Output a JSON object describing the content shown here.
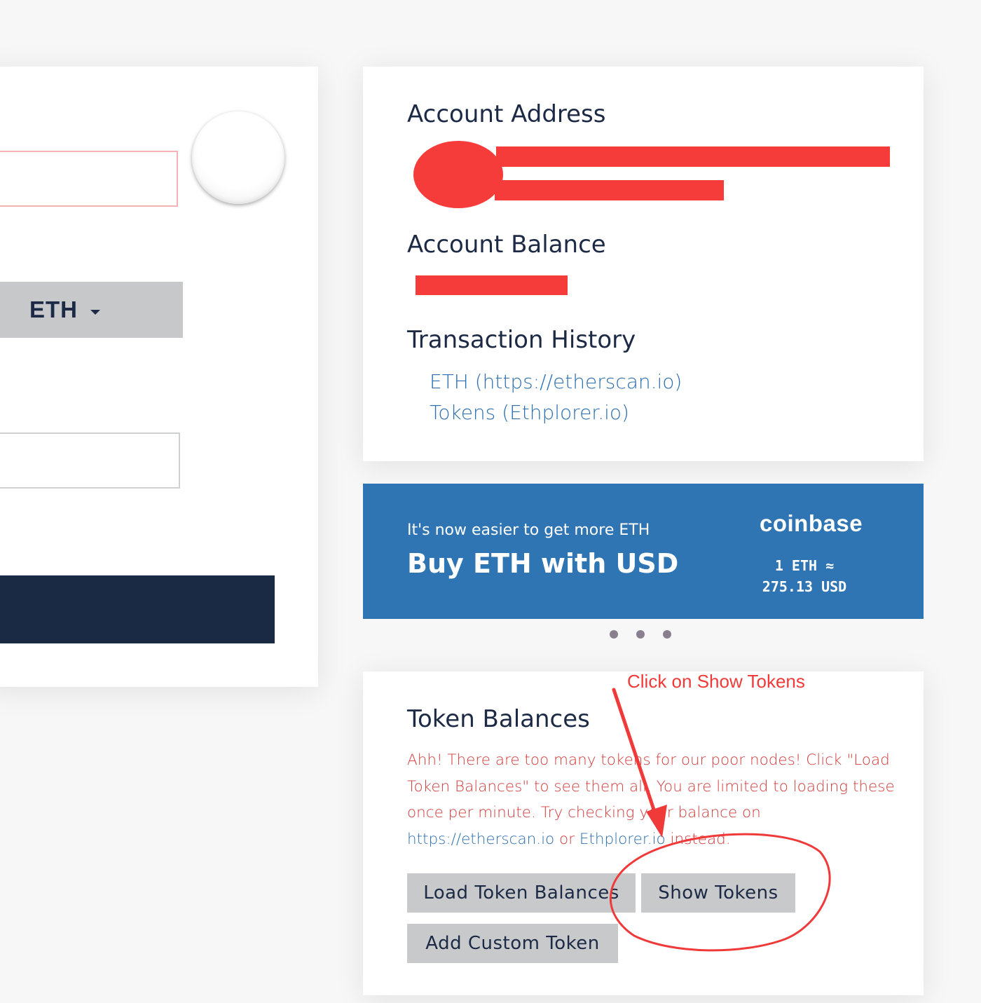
{
  "left_panel": {
    "currency_dropdown": "ETH"
  },
  "account": {
    "address_heading": "Account Address",
    "balance_heading": "Account Balance",
    "history_heading": "Transaction History",
    "history_links": [
      "ETH (https://etherscan.io)",
      "Tokens (Ethplorer.io)"
    ]
  },
  "banner": {
    "subtitle": "It's now easier to get more ETH",
    "title": "Buy ETH with USD",
    "brand": "coinbase",
    "rate_line1": "1 ETH ≈",
    "rate_line2": "275.13 USD",
    "carousel_dots": 3
  },
  "tokens": {
    "heading": "Token Balances",
    "message_part1": "Ahh! There are too many tokens for our poor nodes! Click \"Load Token Balances\" to see them all. You are limited to loading these once per minute. Try checking your balance on ",
    "message_link1": "https://etherscan.io",
    "message_part2": " or ",
    "message_link2": "Ethplorer.io",
    "message_part3": " instead.",
    "buttons": {
      "load": "Load Token Balances",
      "show": "Show Tokens",
      "add": "Add Custom Token"
    }
  },
  "annotation": {
    "text": "Click on Show Tokens",
    "color": "#f03a3a"
  },
  "colors": {
    "redaction": "#f63b3b",
    "banner": "#2f74b3",
    "dark_button": "#1b2a44",
    "link": "#2c6fb0",
    "warning_text": "#d23c3c",
    "gray_button": "#c7c9cb"
  }
}
